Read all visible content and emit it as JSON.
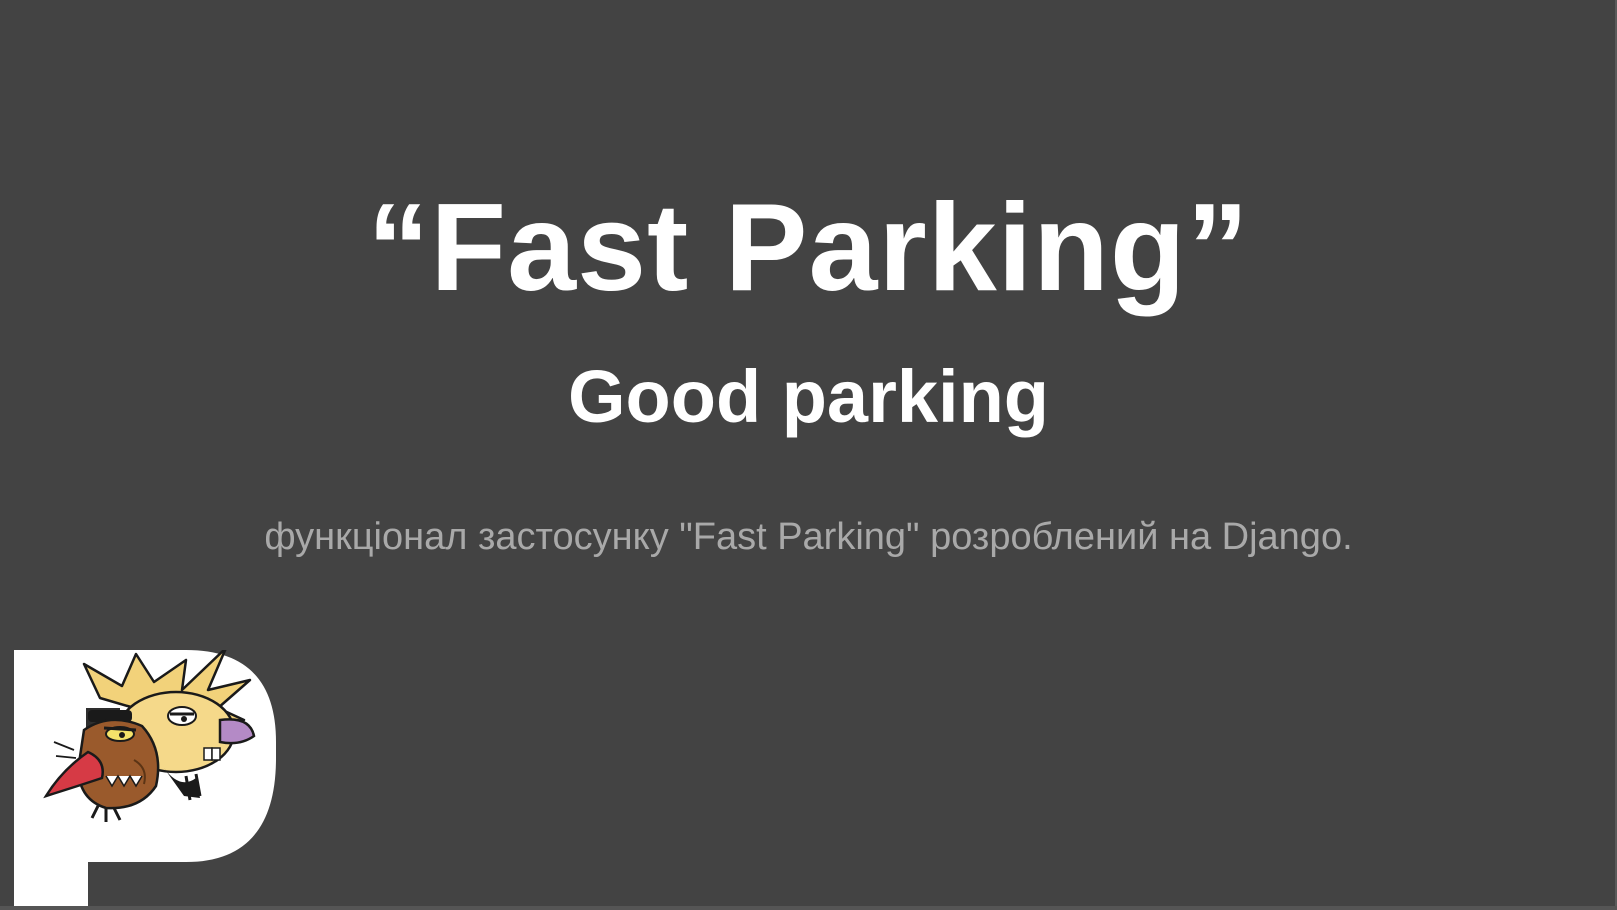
{
  "slide": {
    "title": "“Fast Parking”",
    "subtitle": "Good parking",
    "description": "функціонал застосунку \"Fast Parking\" розроблений на Django."
  },
  "logo": {
    "icon": "parking-p-logo-with-cartoon-beavers"
  },
  "colors": {
    "background": "#434343",
    "title": "#ffffff",
    "description": "#a9a9a9",
    "logo_plate": "#ffffff"
  }
}
